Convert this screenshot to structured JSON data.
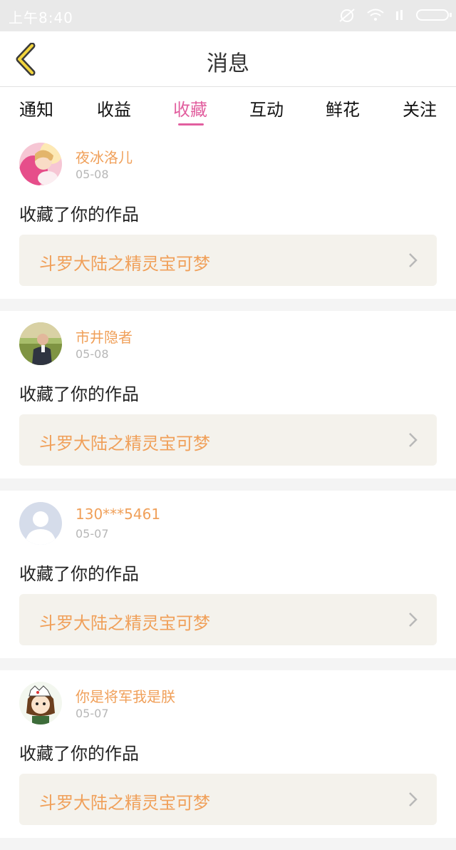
{
  "status_bar": {
    "time": "上午8:40"
  },
  "header": {
    "title": "消息"
  },
  "tabs": [
    {
      "label": "通知",
      "active": false
    },
    {
      "label": "收益",
      "active": false
    },
    {
      "label": "收藏",
      "active": true
    },
    {
      "label": "互动",
      "active": false
    },
    {
      "label": "鲜花",
      "active": false
    },
    {
      "label": "关注",
      "active": false
    }
  ],
  "colors": {
    "accent": "#e25f9f",
    "name": "#f0a05a",
    "card_box": "#f4f2ec"
  },
  "messages": [
    {
      "user": "夜冰洛儿",
      "date": "05-08",
      "action": "收藏了你的作品",
      "work": "斗罗大陆之精灵宝可梦",
      "avatar": "avatar-pink"
    },
    {
      "user": "市井隐者",
      "date": "05-08",
      "action": "收藏了你的作品",
      "work": "斗罗大陆之精灵宝可梦",
      "avatar": "avatar-man"
    },
    {
      "user": "130***5461",
      "date": "05-07",
      "action": "收藏了你的作品",
      "work": "斗罗大陆之精灵宝可梦",
      "avatar": "avatar-default"
    },
    {
      "user": "你是将军我是朕",
      "date": "05-07",
      "action": "收藏了你的作品",
      "work": "斗罗大陆之精灵宝可梦",
      "avatar": "avatar-cartoon"
    }
  ]
}
